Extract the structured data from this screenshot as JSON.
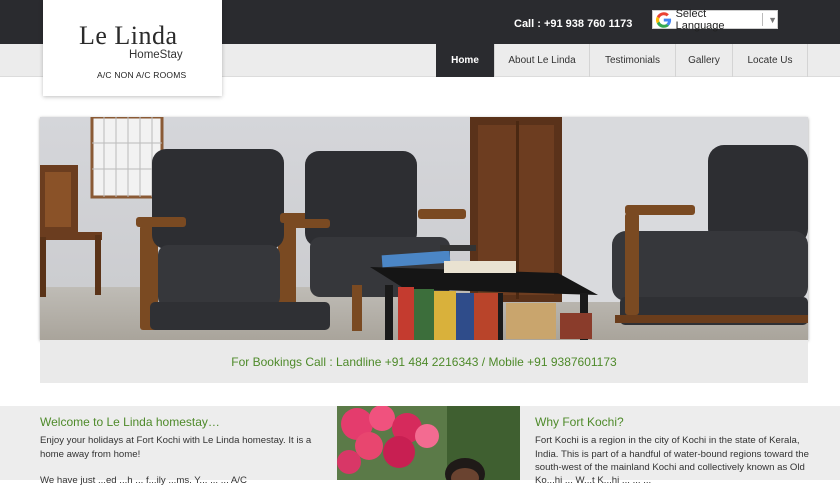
{
  "brand": {
    "name": "Le Linda",
    "subtitle": "HomeStay",
    "rooms": "A/C NON A/C ROOMS"
  },
  "header": {
    "call": "Call : +91 938 760 1173",
    "language_label": "Select Language",
    "language_arrow": "▼"
  },
  "nav": {
    "items": [
      {
        "label": "Home",
        "active": true
      },
      {
        "label": "About  Le Linda"
      },
      {
        "label": "Testimonials"
      },
      {
        "label": "Gallery"
      },
      {
        "label": "Locate Us"
      }
    ]
  },
  "booking": {
    "text": "For Bookings Call : Landline +91 484 2216343 / Mobile +91 9387601173"
  },
  "welcome": {
    "title": "Welcome to Le Linda homestay…",
    "line1": "Enjoy your holidays at Fort Kochi with Le Linda homestay. It is a",
    "line2": "home away from home!",
    "line3": "We have just ...ed ...h ... f...ily ...ms. Y... ... ... A/C"
  },
  "why": {
    "title": "Why Fort Kochi?",
    "line1": "Fort Kochi is a region in the city of Kochi in the state of Kerala,",
    "line2": "India. This is part of a handful of water-bound regions toward the",
    "line3": "south-west of the mainland Kochi and collectively known as Old",
    "line4": "Ko...hi ... W...t K...hi ... ... ..."
  },
  "colors": {
    "dark": "#2a2b2f",
    "accent_green": "#4e8a2a",
    "light_bg": "#ececec"
  }
}
